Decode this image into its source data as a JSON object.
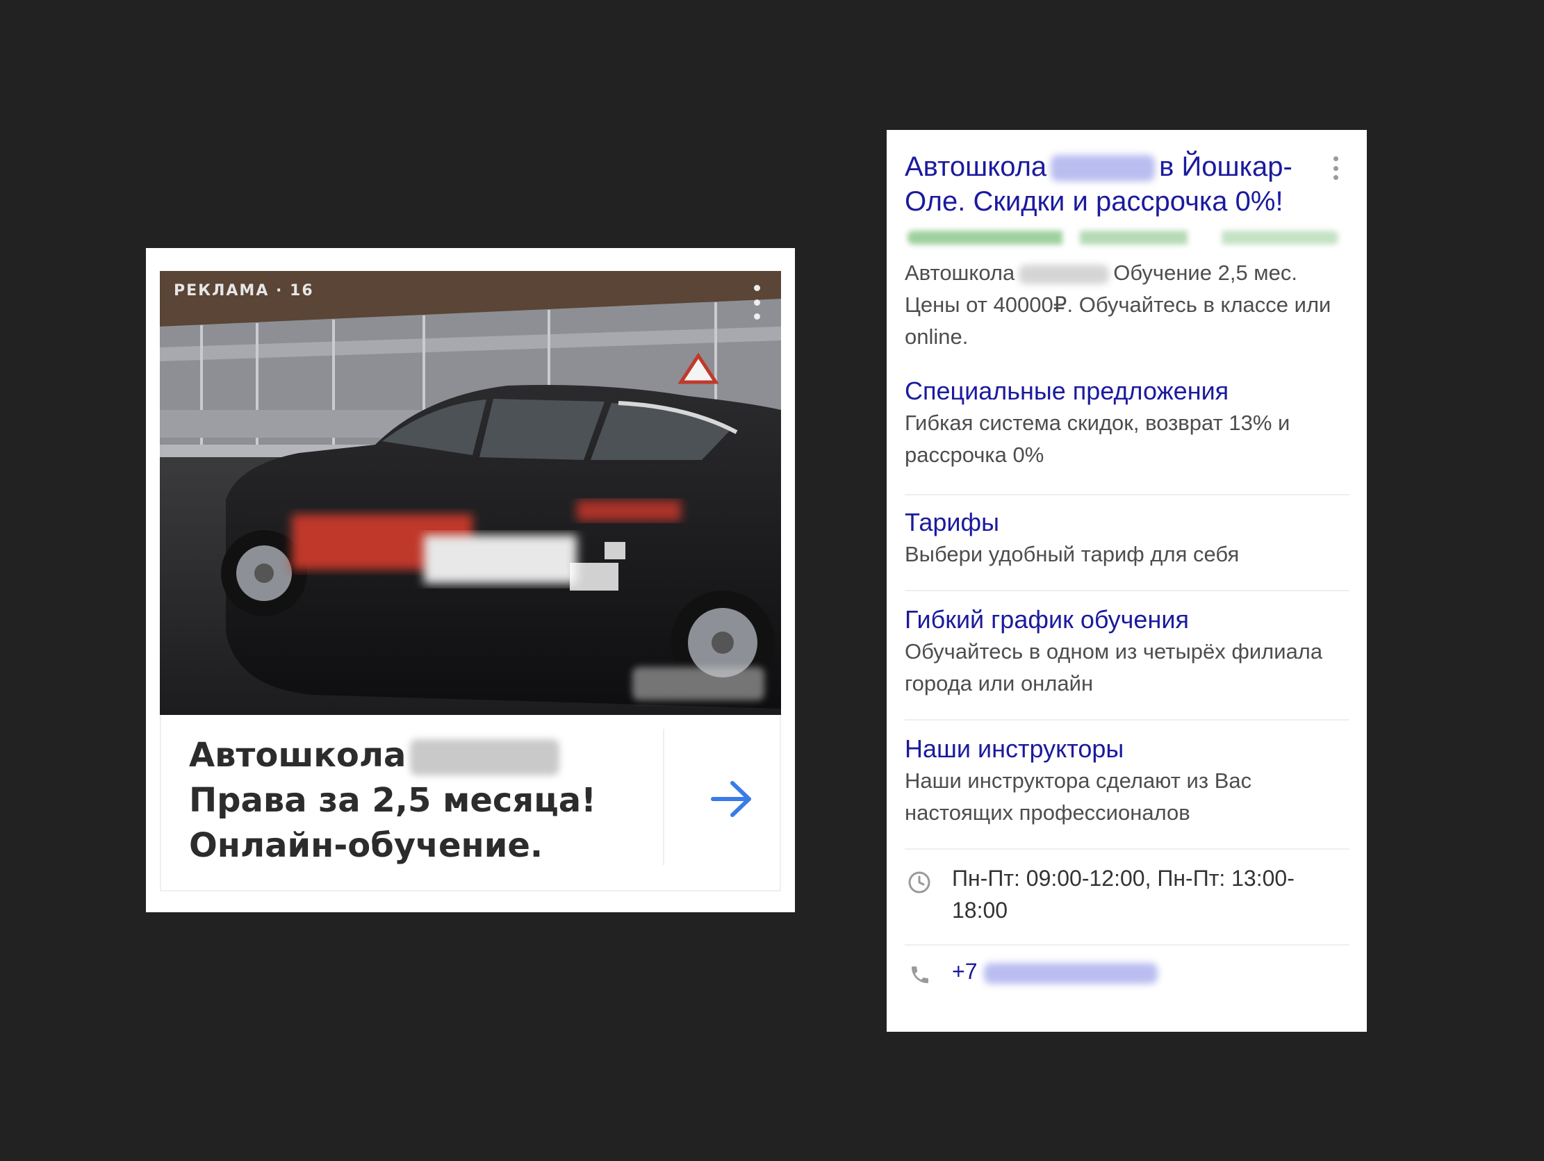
{
  "left_ad": {
    "label": "РЕКЛАМА · 16",
    "headline_line1": "Автошкола",
    "headline_line2": "Права за 2,5 месяца!",
    "headline_line3": "Онлайн-обучение.",
    "arrow_icon": "arrow-right-icon",
    "accent_color": "#3a7bea"
  },
  "right_ad": {
    "title_part1": "Автошкола",
    "title_part2": "в Йошкар-Оле. Скидки и рассрочка 0%!",
    "desc_part1": "Автошкола",
    "desc_part2": "Обучение 2,5 мес. Цены от 40000₽. Обучайтесь в классе или online.",
    "sitelinks": [
      {
        "title": "Специальные предложения",
        "desc": "Гибкая система скидок, возврат 13% и рассрочка 0%"
      },
      {
        "title": "Тарифы",
        "desc": "Выбери удобный тариф для себя"
      },
      {
        "title": "Гибкий график обучения",
        "desc": "Обучайтесь в одном из четырёх филиала города или онлайн"
      },
      {
        "title": "Наши инструкторы",
        "desc": "Наши инструктора сделают из Вас настоящих профессионалов"
      }
    ],
    "hours": "Пн-Пт: 09:00-12:00, Пн-Пт: 13:00-18:00",
    "phone_prefix": "+7",
    "link_color": "#1b1a9e",
    "icons": [
      "clock-icon",
      "phone-icon",
      "more-vertical-icon"
    ]
  }
}
